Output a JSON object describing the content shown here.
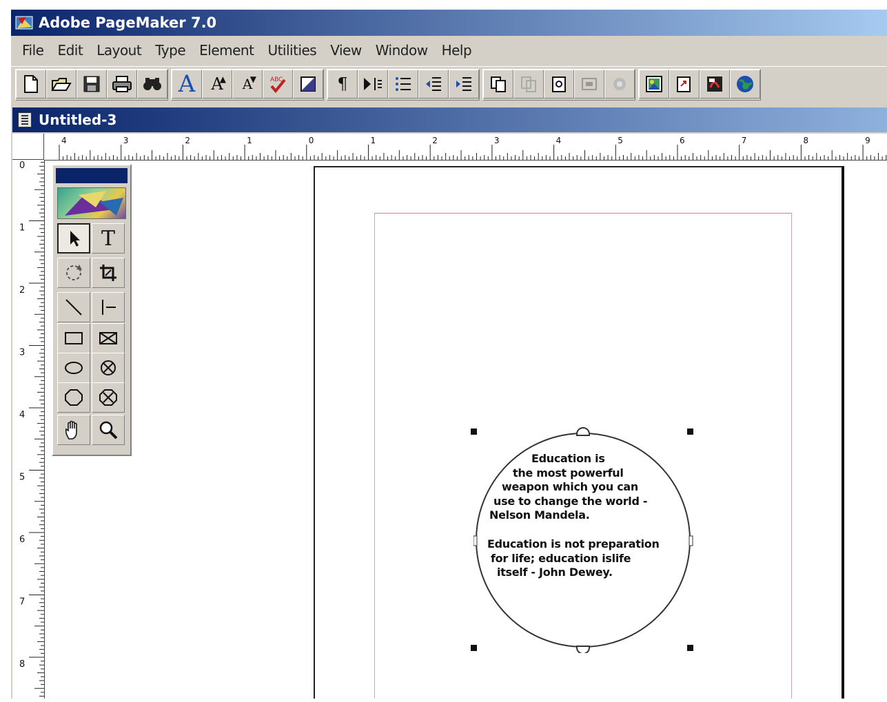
{
  "app": {
    "title": "Adobe PageMaker 7.0",
    "icon": "pagemaker-app-icon"
  },
  "menubar": {
    "items": [
      "File",
      "Edit",
      "Layout",
      "Type",
      "Element",
      "Utilities",
      "View",
      "Window",
      "Help"
    ]
  },
  "toolbar": {
    "groups": [
      [
        "new-document-icon",
        "open-icon",
        "save-icon",
        "print-icon",
        "find-icon"
      ],
      [
        "font-icon",
        "increase-size-icon",
        "decrease-size-icon",
        "spell-check-icon",
        "fill-stroke-icon"
      ],
      [
        "paragraph-icon",
        "indents-icon",
        "bullets-icon",
        "outdent-icon",
        "indent-icon"
      ],
      [
        "copy-page-icon",
        "paste-disabled-icon",
        "frame-icon",
        "image-disabled-icon",
        "link-disabled-icon"
      ],
      [
        "place-image-icon",
        "export-icon",
        "pdf-icon",
        "web-icon"
      ]
    ],
    "big_a": "A",
    "small_a": "A",
    "pilcrow": "¶"
  },
  "document": {
    "title": "Untitled-3",
    "horizontal_ruler_labels": [
      "4",
      "3",
      "2",
      "1",
      "0",
      "1",
      "2",
      "3",
      "4",
      "5",
      "6",
      "7",
      "8",
      "9"
    ],
    "vertical_ruler_labels": [
      "0",
      "1",
      "2",
      "3",
      "4",
      "5",
      "6",
      "7",
      "8"
    ]
  },
  "toolbox": {
    "tools": [
      "pointer-tool",
      "text-tool",
      "rotate-tool",
      "crop-tool",
      "line-tool",
      "constrained-line-tool",
      "rectangle-tool",
      "rectangle-frame-tool",
      "ellipse-tool",
      "ellipse-frame-tool",
      "polygon-tool",
      "polygon-frame-tool",
      "hand-tool",
      "zoom-tool"
    ],
    "text_tool_label": "T"
  },
  "quote": {
    "lines1": [
      "Education is",
      "the most powerful",
      "weapon which you can",
      "use to change the world -",
      "Nelson Mandela."
    ],
    "lines2": [
      "Education is not preparation",
      "for life; education islife",
      "itself - John Dewey."
    ]
  },
  "colors": {
    "title_bar": "#0a246a",
    "chrome": "#d4d0c8",
    "margin_guide": "#c8a0d8"
  }
}
